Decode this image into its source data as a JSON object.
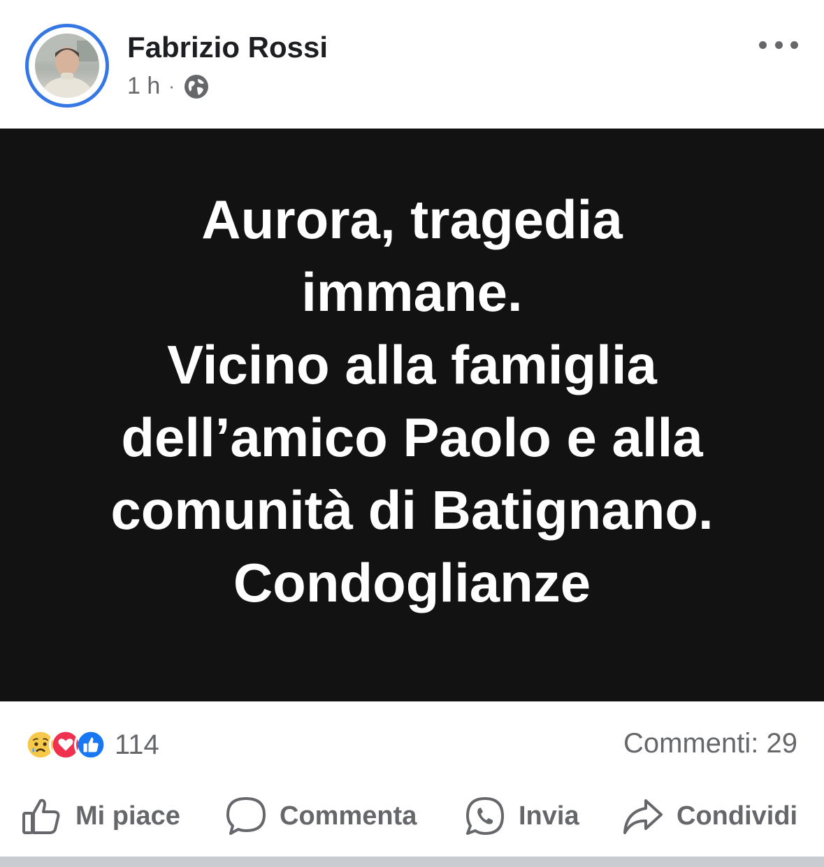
{
  "post": {
    "author": "Fabrizio Rossi",
    "time": "1 h",
    "separator": "·",
    "privacy_icon": "globe-icon",
    "more_icon": "more-horizontal-icon",
    "image_text": "Aurora, tragedia\nimmane.\nVicino alla famiglia\ndell’amico Paolo e alla\ncomunità di Batignano.\nCondoglianze"
  },
  "stats": {
    "reaction_icons": [
      "sad-reaction-icon",
      "love-reaction-icon",
      "like-reaction-icon"
    ],
    "reaction_count": "114",
    "comments": "Commenti: 29"
  },
  "actions": {
    "like": "Mi piace",
    "comment": "Commenta",
    "send": "Invia",
    "share": "Condividi"
  },
  "colors": {
    "accent": "#3578e5",
    "image_background": "#121212",
    "secondary_text": "#65676b"
  }
}
